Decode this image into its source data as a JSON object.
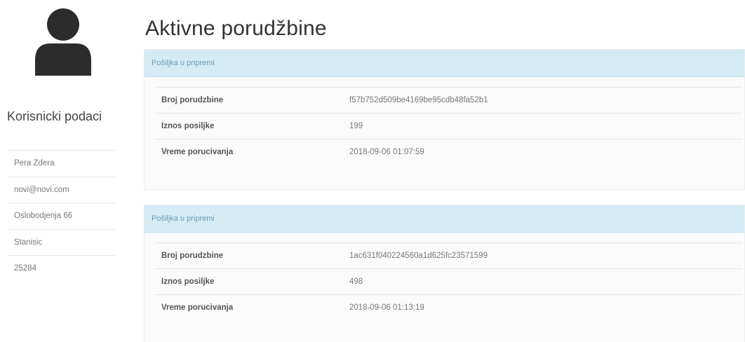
{
  "sidebar": {
    "title": "Korisnicki podaci",
    "items": [
      {
        "value": "Pera Zdera"
      },
      {
        "value": "novi@novi.com"
      },
      {
        "value": "Oslobodjenja 66"
      },
      {
        "value": "Stanisic"
      },
      {
        "value": "25284"
      }
    ]
  },
  "main": {
    "title": "Aktivne porudžbine",
    "orders": [
      {
        "heading": "Pošiljka u pripremi",
        "rows": [
          {
            "label": "Broj porudzbine",
            "value": "f57b752d509be4169be95cdb48fa52b1"
          },
          {
            "label": "Iznos posiljke",
            "value": "199"
          },
          {
            "label": "Vreme porucivanja",
            "value": "2018-09-06 01:07:59"
          }
        ]
      },
      {
        "heading": "Pošiljka u pripremi",
        "rows": [
          {
            "label": "Broj porudzbine",
            "value": "1ac631f040224560a1d625fc23571599"
          },
          {
            "label": "Iznos posiljke",
            "value": "498"
          },
          {
            "label": "Vreme porucivanja",
            "value": "2018-09-06 01:13:19"
          }
        ]
      }
    ]
  },
  "icons": {
    "avatar": "user-avatar-icon"
  },
  "colors": {
    "panel_heading_bg": "#d5ebf6",
    "panel_heading_text": "#6a9bb5",
    "avatar": "#2c2c2c"
  }
}
